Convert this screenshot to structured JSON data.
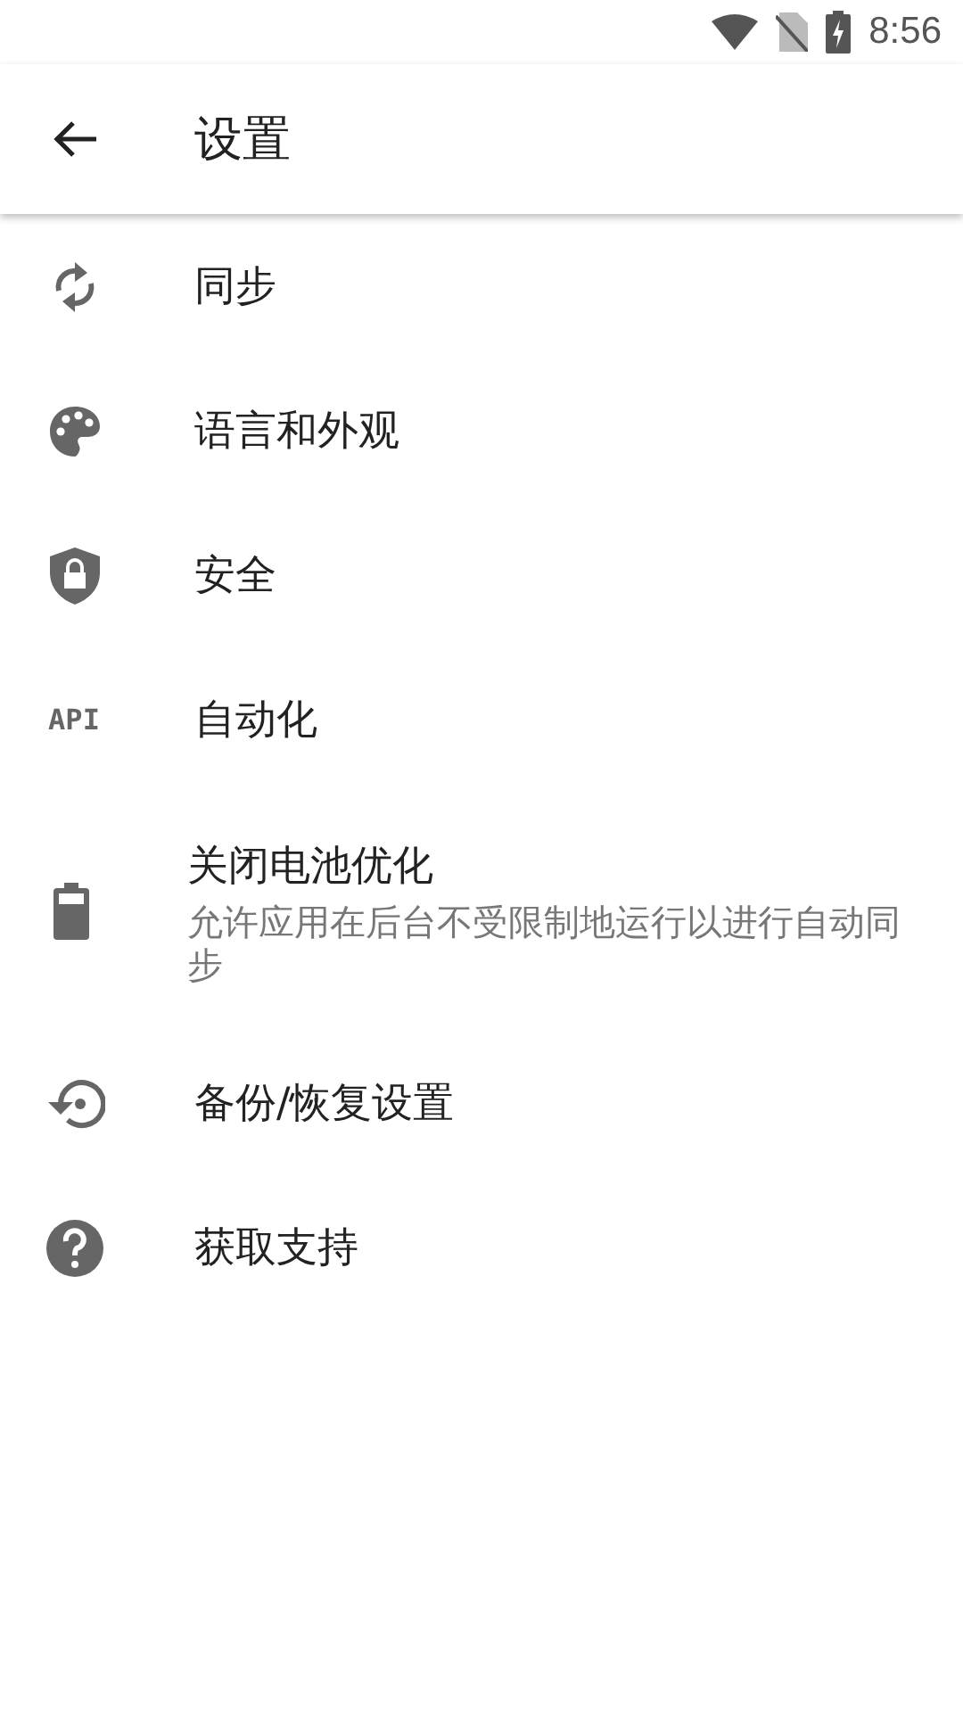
{
  "status_bar": {
    "time": "8:56"
  },
  "app_bar": {
    "title": "设置"
  },
  "items": [
    {
      "kind": "sync",
      "title": "同步"
    },
    {
      "kind": "palette",
      "title": "语言和外观"
    },
    {
      "kind": "shield",
      "title": "安全"
    },
    {
      "kind": "text",
      "icon_text": "API",
      "title": "自动化"
    },
    {
      "kind": "battery",
      "title": "关闭电池优化",
      "subtitle": "允许应用在后台不受限制地运行以进行自动同步"
    },
    {
      "kind": "restore",
      "title": "备份/恢复设置"
    },
    {
      "kind": "help",
      "title": "获取支持"
    }
  ]
}
